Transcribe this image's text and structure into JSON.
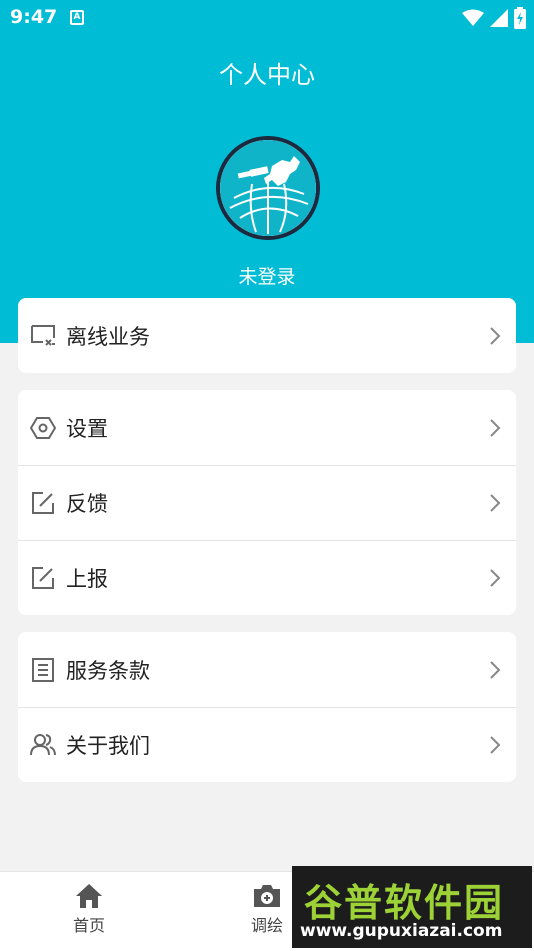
{
  "status_bar": {
    "time": "9:47",
    "notification_icon": "A"
  },
  "header": {
    "title": "个人中心",
    "login_status": "未登录"
  },
  "menu": {
    "offline": {
      "label": "离线业务",
      "icon": "offline-icon"
    },
    "settings": {
      "label": "设置",
      "icon": "settings-icon"
    },
    "feedback": {
      "label": "反馈",
      "icon": "edit-icon"
    },
    "report": {
      "label": "上报",
      "icon": "edit-icon"
    },
    "terms": {
      "label": "服务条款",
      "icon": "document-icon"
    },
    "about": {
      "label": "关于我们",
      "icon": "users-icon"
    }
  },
  "bottom_nav": {
    "home": {
      "label": "首页",
      "icon": "home-icon"
    },
    "survey": {
      "label": "调绘",
      "icon": "camera-icon"
    }
  },
  "watermark": {
    "logo": "谷普软件园",
    "url": "www.gupuxiazai.com"
  },
  "colors": {
    "accent": "#00bcd4",
    "background": "#f2f2f2",
    "watermark_green": "#9cd236"
  }
}
